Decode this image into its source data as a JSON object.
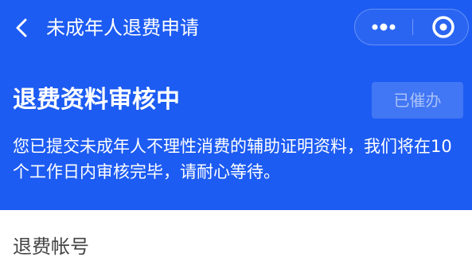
{
  "nav": {
    "title": "未成年人退费申请"
  },
  "status": {
    "title": "退费资料审核中",
    "reminded_label": "已催办",
    "description": "您已提交未成年人不理性消费的辅助证明资料，我们将在10个工作日内审核完毕，请耐心等待。"
  },
  "form": {
    "account_label": "退费帐号"
  },
  "colors": {
    "primary_blue": "#1d5cf2",
    "text_white": "#ffffff",
    "label_gray": "#444444"
  },
  "icons": {
    "back": "chevron-left-icon",
    "more": "more-dots-icon",
    "close": "circle-dot-icon"
  }
}
